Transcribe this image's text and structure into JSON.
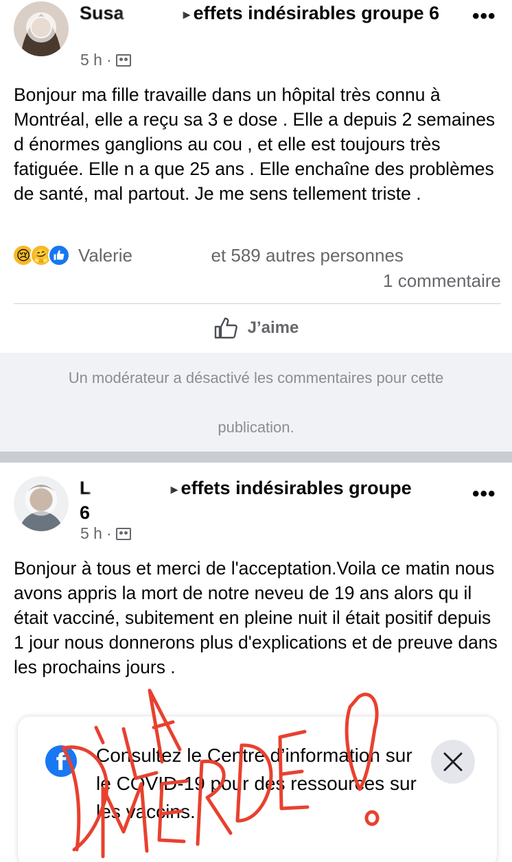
{
  "posts": [
    {
      "author_partial": "Susa",
      "group": "effets indésirables groupe 6",
      "time": "5 h",
      "body": "Bonjour ma fille travaille dans un hôpital très connu à Montréal, elle a reçu sa 3 e dose . Elle a depuis 2 semaines d énormes ganglions au cou , et elle est toujours très fatiguée. Elle n a que 25 ans . Elle enchaîne des problèmes de santé, mal partout. Je me sens tellement triste .",
      "reactions_first_name": "Valerie",
      "reactions_rest": "et 589 autres personnes",
      "comments_count": "1 commentaire",
      "like_label": "J’aime",
      "moderation_line1": "Un modérateur a désactivé les commentaires pour cette",
      "moderation_line2": "publication."
    },
    {
      "author_partial": "L",
      "group_line1": "effets indésirables groupe",
      "group_line2": "6",
      "time": "5 h",
      "body": "Bonjour à tous et merci de l'acceptation.Voila ce matin nous avons appris la mort de notre neveu de 19 ans alors qu il était vacciné, subitement en pleine nuit il était positif depuis 1 jour nous donnerons plus d'explications et de preuve dans les prochains jours ."
    }
  ],
  "covid_banner": {
    "text": "Consultez le Centre d’information sur le COVID-19 pour des ressources sur les vaccins."
  },
  "overlay_scrawl": "D'LA MERDE!",
  "icons": {
    "more": "more-options-icon",
    "audience": "group-audience-icon",
    "like": "thumbs-up-icon",
    "close": "close-icon",
    "facebook": "facebook-icon"
  },
  "colors": {
    "accent": "#1877f2",
    "scrawl": "#e8412f",
    "muted": "#65676b"
  }
}
